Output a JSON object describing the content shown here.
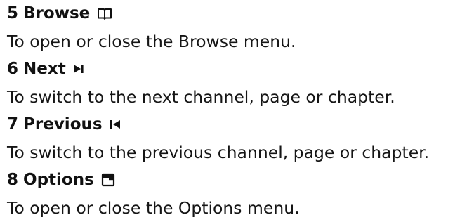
{
  "entries": [
    {
      "number": "5",
      "title": "Browse",
      "icon": "book-icon",
      "description": "To open or close the Browse menu."
    },
    {
      "number": "6",
      "title": "Next",
      "icon": "skip-next-icon",
      "description": "To switch to the next channel, page or chapter."
    },
    {
      "number": "7",
      "title": "Previous",
      "icon": "skip-previous-icon",
      "description": "To switch to the previous channel, page or chapter."
    },
    {
      "number": "8",
      "title": "Options",
      "icon": "options-menu-icon",
      "description": "To open or close the Options menu."
    }
  ]
}
